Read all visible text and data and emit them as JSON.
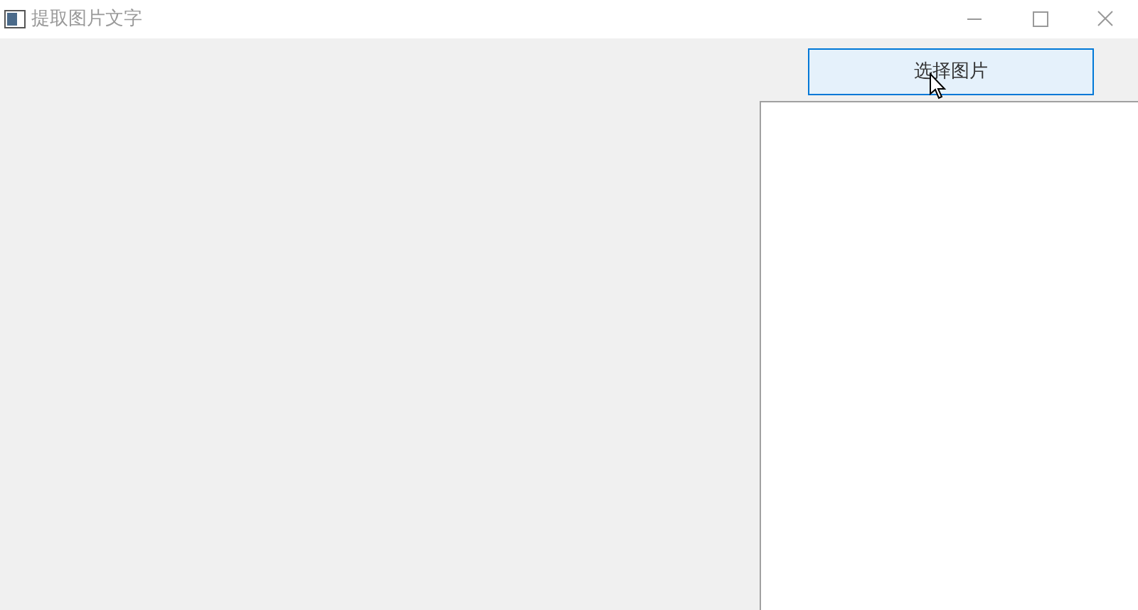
{
  "window": {
    "title": "提取图片文字"
  },
  "select_button": {
    "label": "选择图片",
    "hovered": true
  }
}
